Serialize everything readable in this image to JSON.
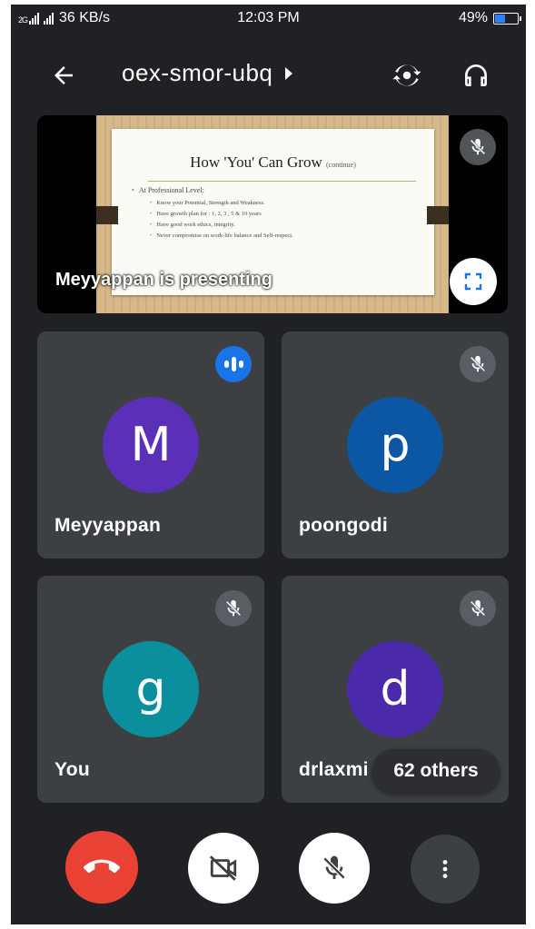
{
  "status_bar": {
    "network": "2G",
    "data_speed": "36 KB/s",
    "time": "12:03 PM",
    "battery_percent": "49%",
    "battery_level": 0.49
  },
  "header": {
    "meeting_code": "oex-smor-ubq",
    "icons": [
      "back-arrow-icon",
      "switch-camera-icon",
      "headphones-icon"
    ]
  },
  "presentation": {
    "label": "Meyyappan is presenting",
    "slide": {
      "title": "How 'You' Can Grow",
      "title_suffix": "(continue)",
      "heading": "At Professional Level:",
      "bullets": [
        "Know your Potential, Strength and Weakness.",
        "Have growth plan for : 1, 2, 3 , 5 & 10 years",
        "Have good work ethics, integrity.",
        "Never compromise on work-life balance and Self-respect."
      ]
    }
  },
  "participants": [
    {
      "name": "Meyyappan",
      "initial": "M",
      "color": "#5b2fb8",
      "status": "speaking"
    },
    {
      "name": "poongodi",
      "initial": "p",
      "color": "#0b57a4",
      "status": "muted"
    },
    {
      "name": "You",
      "initial": "g",
      "color": "#0b8f9c",
      "status": "muted"
    },
    {
      "name": "drlaxmi",
      "initial": "d",
      "color": "#4a2aa8",
      "status": "muted"
    }
  ],
  "others": {
    "label": "62 others"
  },
  "controls": {
    "icons": [
      "end-call-icon",
      "camera-off-icon",
      "mic-off-icon",
      "more-vert-icon"
    ],
    "colors": {
      "end_call": "#ea4335",
      "speaking_badge": "#1a73e8"
    }
  }
}
